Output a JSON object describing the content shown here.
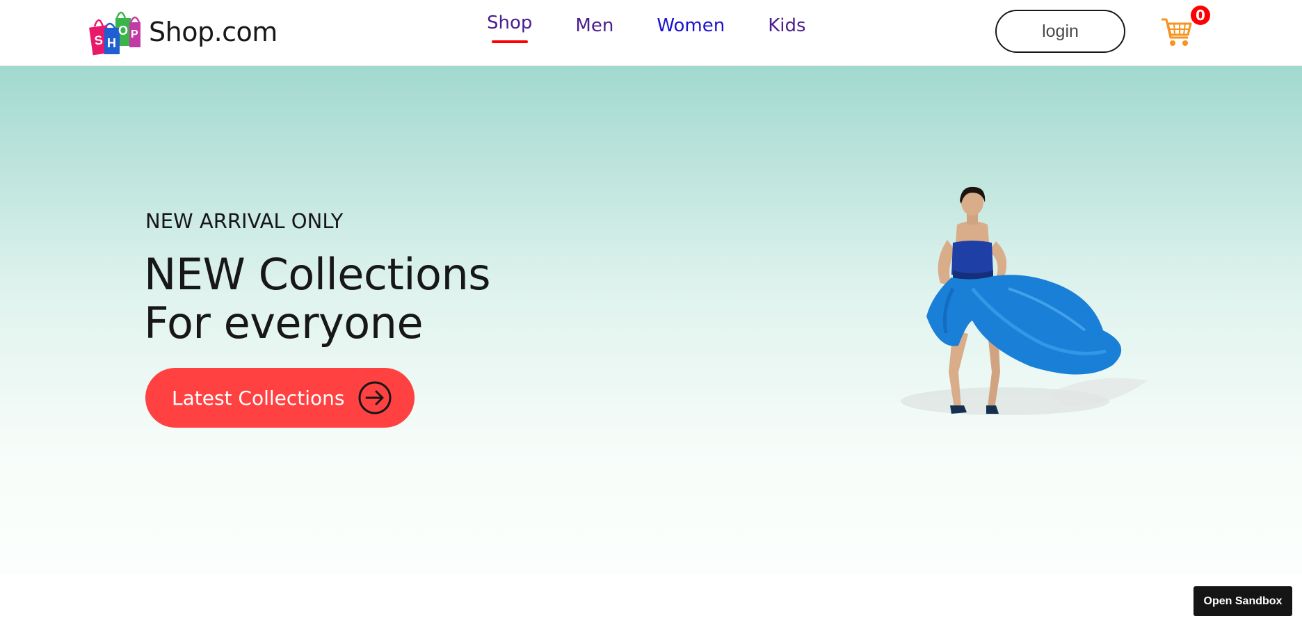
{
  "navbar": {
    "brand_name": "Shop.com",
    "logo_text": "SHOP",
    "menu": [
      {
        "label": "Shop",
        "active": true
      },
      {
        "label": "Men",
        "active": false
      },
      {
        "label": "Women",
        "active": false
      },
      {
        "label": "Kids",
        "active": false
      }
    ],
    "login_label": "login",
    "cart_icon": "shopping-cart-icon",
    "cart_count": "0"
  },
  "hero": {
    "eyebrow": "NEW ARRIVAL ONLY",
    "title_line1": "NEW Collections",
    "title_line2": "For everyone",
    "cta_label": "Latest Collections",
    "cta_icon": "arrow-right-circle-icon",
    "image": "woman in flowing blue gown"
  },
  "sandbox": {
    "label": "Open Sandbox"
  },
  "colors": {
    "accent_red": "#ff4141",
    "active_underline": "#ff0000",
    "nav_purple": "#4b1d8f",
    "nav_blue": "#1b12d1",
    "cart_orange": "#f7931e",
    "hero_top": "#a2d9cf",
    "hero_bottom": "#fbfefc"
  }
}
